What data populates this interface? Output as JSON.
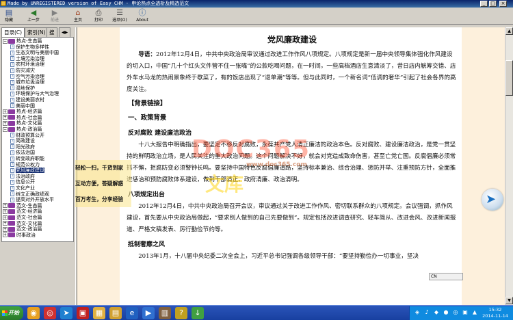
{
  "window": {
    "title": "Made by UNREGISTERED version of Easy CHM - 申论热点全透析及精选范文",
    "controls": [
      "_",
      "□",
      "×"
    ]
  },
  "toolbar": {
    "buttons": [
      {
        "label": "隐藏",
        "icon": "hide-icon"
      },
      {
        "label": "上一步",
        "icon": "back-icon"
      },
      {
        "label": "前进",
        "icon": "forward-icon"
      },
      {
        "label": "主页",
        "icon": "home-icon"
      },
      {
        "label": "打印",
        "icon": "print-icon"
      },
      {
        "label": "选项(O)",
        "icon": "options-icon"
      },
      {
        "label": "About",
        "icon": "about-icon"
      }
    ]
  },
  "nav": {
    "tabs": [
      "目录(C)",
      "索引(N)",
      "搜"
    ],
    "tab_arrows": "◀▶"
  },
  "tree": {
    "items": [
      {
        "label": "热点-生态篇",
        "level": 0,
        "kind": "book",
        "expanded": true
      },
      {
        "label": "保护生物多样性",
        "level": 1,
        "kind": "page"
      },
      {
        "label": "生态文明与美丽中国",
        "level": 1,
        "kind": "page"
      },
      {
        "label": "土壤污染治理",
        "level": 1,
        "kind": "page"
      },
      {
        "label": "农村环境治理",
        "level": 1,
        "kind": "page"
      },
      {
        "label": "防灾减灾",
        "level": 1,
        "kind": "page"
      },
      {
        "label": "空气污染治理",
        "level": 1,
        "kind": "page"
      },
      {
        "label": "城市垃圾治理",
        "level": 1,
        "kind": "page"
      },
      {
        "label": "湿地保护",
        "level": 1,
        "kind": "page"
      },
      {
        "label": "环境保护与大气治理",
        "level": 1,
        "kind": "page"
      },
      {
        "label": "建设美丽农村",
        "level": 1,
        "kind": "page"
      },
      {
        "label": "美丽中国",
        "level": 1,
        "kind": "page"
      },
      {
        "label": "热点-经济篇",
        "level": 0,
        "kind": "book",
        "expanded": false
      },
      {
        "label": "热点-社会篇",
        "level": 0,
        "kind": "book",
        "expanded": false
      },
      {
        "label": "热点-文化篇",
        "level": 0,
        "kind": "book",
        "expanded": false
      },
      {
        "label": "热点-政治篇",
        "level": 0,
        "kind": "book",
        "expanded": true
      },
      {
        "label": "财政预算公开",
        "level": 1,
        "kind": "page"
      },
      {
        "label": "简政建设",
        "level": 1,
        "kind": "page"
      },
      {
        "label": "阳光政府",
        "level": 1,
        "kind": "page"
      },
      {
        "label": "依法治国",
        "level": 1,
        "kind": "page"
      },
      {
        "label": "转变政府职能",
        "level": 1,
        "kind": "page"
      },
      {
        "label": "规范公权力",
        "level": 1,
        "kind": "page"
      },
      {
        "label": "党风廉政建设",
        "level": 1,
        "kind": "page",
        "selected": true
      },
      {
        "label": "法治政府",
        "level": 1,
        "kind": "page"
      },
      {
        "label": "信息公开",
        "level": 1,
        "kind": "page"
      },
      {
        "label": "文化产业",
        "level": 1,
        "kind": "page"
      },
      {
        "label": "树立正确政绩观",
        "level": 1,
        "kind": "page"
      },
      {
        "label": "提高对外开放水平",
        "level": 1,
        "kind": "page"
      },
      {
        "label": "范文-生态篇",
        "level": 0,
        "kind": "book",
        "expanded": false
      },
      {
        "label": "范文-经济篇",
        "level": 0,
        "kind": "book",
        "expanded": false
      },
      {
        "label": "范文-社会篇",
        "level": 0,
        "kind": "book",
        "expanded": false
      },
      {
        "label": "范文-文化篇",
        "level": 0,
        "kind": "book",
        "expanded": false
      },
      {
        "label": "范文-政治篇",
        "level": 0,
        "kind": "book",
        "expanded": false
      },
      {
        "label": "时事政治",
        "level": 0,
        "kind": "book",
        "expanded": false
      }
    ]
  },
  "article": {
    "title": "党风廉政建设",
    "lead_label": "导语：",
    "lead": "2012年12月4日，中共中央政治局审议通过改进工作作风八项规定。八项规定是新一届中央领导集体强化作风建设的切入口，中国“几十个红头文件管不住一张嘴”的公款吃喝问题，在一时间，一些高档酒店生意清淡了，昔日店内觥筹交错、店外车水马龙的热闹景象终于歇菜了，有的饭店出现了“退单潮”等等。但与此同时，一个新名词“低调的奢华”引起了社会各界的高度关注。",
    "section_bg": "【背景链接】",
    "section_one": "一、政策背景",
    "sub_one": "反对腐败  建设廉洁政治",
    "para_one": "十八大报告中明确指出，要坚定不移反对腐败，永葆共产党人清正廉洁的政治本色。反对腐败、建设廉洁政治，是党一贯坚持的鲜明政治立场，是人民关注的重大政治问题。这个问题解决不好，就会对党造成致命伤害，甚至亡党亡国。反腐倡廉必须常抓不懈，拒腐防变必须警钟长鸣。要坚持中国特色反腐倡廉道路，坚持标本兼治、综合治理、惩防并举、注重预防方针，全面推进惩治和预防腐败体系建设，做到干部清正、政府清廉、政治清明。",
    "sub_two": "八项规定出台",
    "para_two": "2012年12月4日，中共中央政治局召开会议，审议通过关于改进工作作风、密切联系群众的八项规定。会议强调，抓作风建设，首先要从中央政治局做起，“要求别人做到的自己先要做到”。规定包括改进调查研究、轻车简从、改进会风、改进新闻报道、严格文稿发表、厉行勤俭节约等。",
    "sub_three": "抵制奢靡之风",
    "para_three": "2013年1月，十八届中央纪委二次全会上，习近平总书记强调各级领导干部：“要坚持勤俭办一切事业，坚决"
  },
  "overlay": {
    "lines": [
      "轻松一扫，千货到家",
      "互动方便，答疑解惑",
      "百万考生，分享经验"
    ]
  },
  "watermark": {
    "big": "DOC365",
    "mid": "文库",
    "small": "www.doc365.com"
  },
  "ime": {
    "label": "CN"
  },
  "taskbar": {
    "start_label": "开始",
    "quick_icons": [
      "browser-icon",
      "chrome-icon",
      "bird-app-icon",
      "red-app-icon",
      "explorer-icon",
      "folder-icon",
      "ie-icon",
      "media-icon",
      "archive-icon",
      "chm-icon",
      "download-icon"
    ],
    "clock_time": "15:32",
    "clock_date": "2014-11-14"
  },
  "colors": {
    "titlebar": "#0a246a",
    "content_margin": "#fdf0dc",
    "taskbar": "#1840a0",
    "selection": "#0a246a"
  }
}
